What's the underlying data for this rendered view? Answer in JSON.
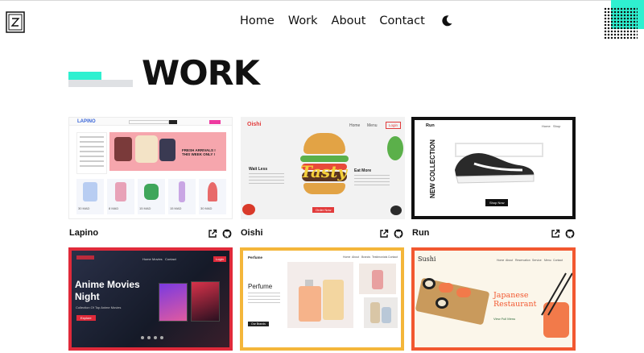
{
  "nav": {
    "items": [
      "Home",
      "Work",
      "About",
      "Contact"
    ]
  },
  "page": {
    "heading": "WORK"
  },
  "colors": {
    "accent": "#2ff0d0",
    "anime_border": "#e02a3a",
    "perfume_border": "#f4b63a",
    "sushi_border": "#f25830"
  },
  "projects": [
    {
      "title": "Lapino",
      "thumb": {
        "brand": "LAPINO",
        "banner": "FRESH ARRIVALS ! THIS WEEK ONLY !",
        "prices": [
          "30 MAD",
          "8 MAD",
          "15 MAD",
          "15 MAD",
          "30 MAD"
        ]
      }
    },
    {
      "title": "Oishi",
      "thumb": {
        "brand": "Oishi",
        "nav": [
          "Home",
          "Menu"
        ],
        "login": "Login",
        "word": "Tasty",
        "left_heading": "Wait Less",
        "right_heading": "Eat More",
        "cta": "Order Now"
      }
    },
    {
      "title": "Run",
      "thumb": {
        "brand": "Run",
        "nav": [
          "Home",
          "Shop"
        ],
        "vertical": "NEW COLLECTION",
        "cta": "Shop Now"
      }
    },
    {
      "title": "",
      "thumb": {
        "nav": [
          "Home",
          "Movies",
          "Contact"
        ],
        "login": "Login",
        "headline": "Anime Movies Night",
        "sub": "Collection Of Top Anime Movies",
        "cta": "Explore"
      }
    },
    {
      "title": "",
      "thumb": {
        "brand": "Perfume",
        "nav": [
          "Home",
          "About",
          "Brands",
          "Testimonials",
          "Contact"
        ],
        "headline": "Perfume",
        "cta": "Our Brands"
      }
    },
    {
      "title": "",
      "thumb": {
        "brand": "Sushi",
        "nav": [
          "Home",
          "About",
          "Reservation",
          "Service",
          "Menu",
          "Contact"
        ],
        "headline": "Japanese Restaurant",
        "cta": "View Full Menu"
      }
    }
  ],
  "icons": {
    "link": "external-link-icon",
    "repo": "github-icon",
    "theme": "moon-icon"
  }
}
